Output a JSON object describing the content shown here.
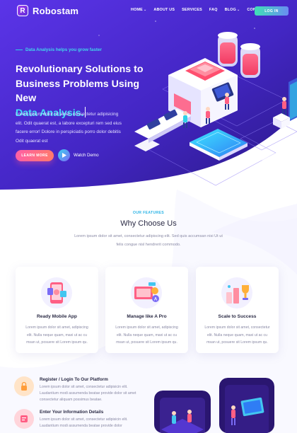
{
  "brand": {
    "name": "Robostam",
    "logo_letter": "R"
  },
  "nav": {
    "items": [
      {
        "label": "HOME",
        "caret": true
      },
      {
        "label": "ABOUT US",
        "caret": false
      },
      {
        "label": "SERVICES",
        "caret": false
      },
      {
        "label": "FAQ",
        "caret": false
      },
      {
        "label": "BLOG",
        "caret": true
      },
      {
        "label": "CONTACT",
        "caret": false
      }
    ],
    "login_label": "LOG IN"
  },
  "hero": {
    "tagline": "Data Analysis helps you grow faster",
    "headline_line1": "Revolutionary Solutions to",
    "headline_line2": "Business Problems Using New",
    "headline_accent": "Data Analysis.",
    "body": "Lorem ipsum dolor sit amet, consectetur adipisicing elit. Odit quaerat est, a labore excepturi rem sed eius facere error! Dolore in perspiciatis porro dolor debitis Odit quaerat est",
    "learn_more": "LEARN MORE",
    "watch_demo": "Watch Demo"
  },
  "features": {
    "label": "OUR FEATURES",
    "title": "Why Choose Us",
    "subtitle": "Lorem ipsum dolor sit amet, consectetur adipiscing elit. Sed quis accumsan nisi Ut ut felis congue nisl hendrerit commodo.",
    "cards": [
      {
        "title": "Ready Mobile App",
        "text": "Lorem ipsum dolor sit amet, adipiscing elit. Nulla neque quam, maxi ut ac cu msan ut, posuere sit Lorem ipsum qu.",
        "icon": "mobile-app-icon"
      },
      {
        "title": "Manage like A Pro",
        "text": "Lorem ipsum dolor sit amet, adipiscing elit. Nulla neque quam, maxi ut ac cu msan ut, posuere sit Lorem ipsum qu.",
        "icon": "manage-pro-icon"
      },
      {
        "title": "Scale to Success",
        "text": "Lorem ipsum dolor sit amet, consectetur elit. Nulla neque quam, maxi ut ac cu msan ut, posuere sit Lorem ipsum qu.",
        "icon": "scale-success-icon"
      }
    ]
  },
  "steps": [
    {
      "title": "Register / Login To Our Platform",
      "text": "Lorem ipsum dolor sit amet, consectetur adipisicin elit. Laudantium modi assumenda beatae provide dolor sit amet consectetur aliquam possimus beatae.",
      "icon": "user-lock-icon"
    },
    {
      "title": "Enter Your Information Details",
      "text": "Lorem ipsum dolor sit amet, consectetur adipisicin elit. Laudantium modi assumenda beatae provide dolor",
      "icon": "info-details-icon"
    }
  ],
  "colors": {
    "hero_start": "#5a2fe0",
    "hero_end": "#2c1a8f",
    "accent_cyan": "#42e0f4",
    "accent_pink": "#ff5fa6",
    "login_start": "#3fe0b5",
    "login_end": "#6a8cf3"
  }
}
